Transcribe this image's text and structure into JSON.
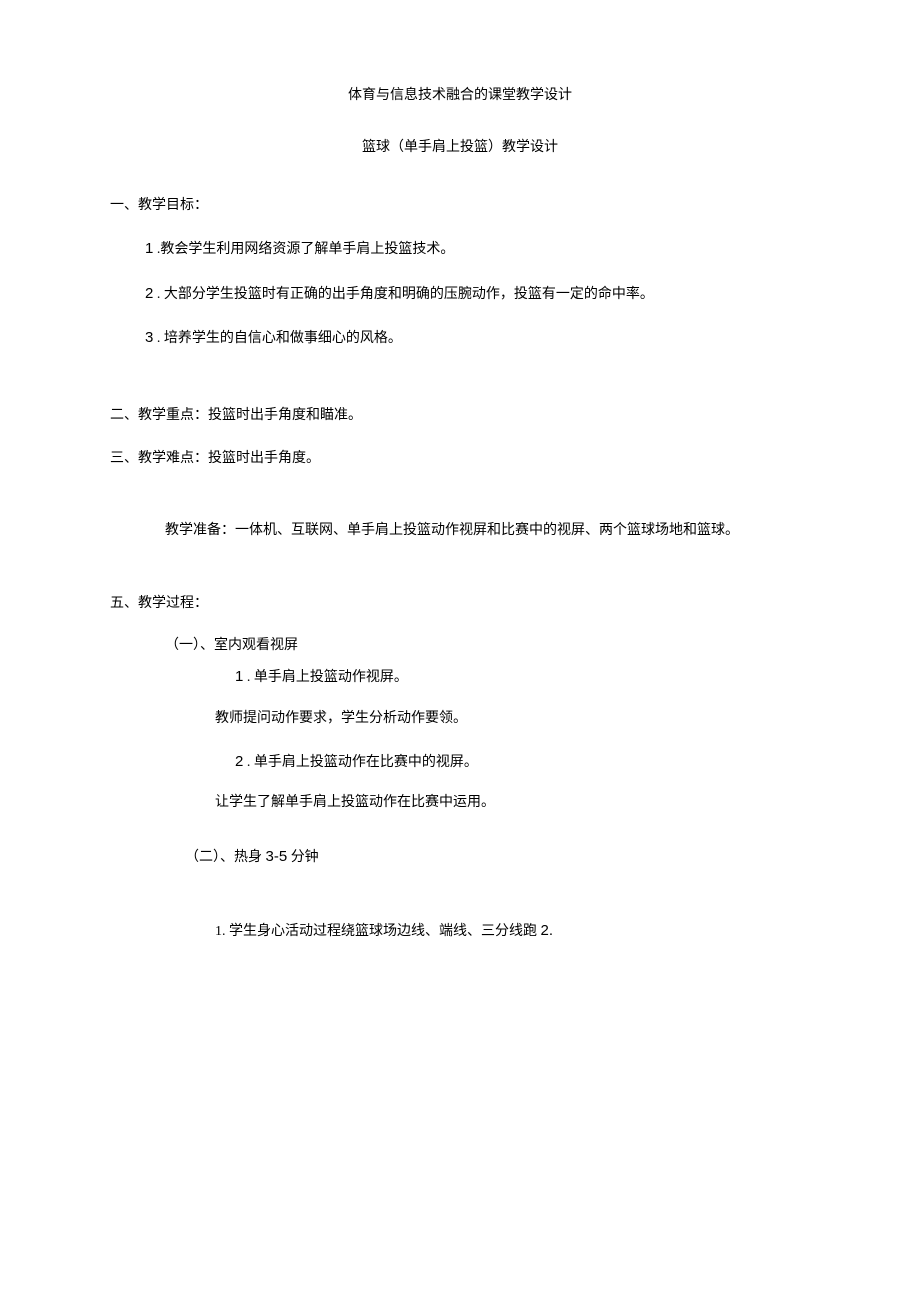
{
  "title": "体育与信息技术融合的课堂教学设计",
  "subtitle": "篮球（单手肩上投篮）教学设计",
  "section1": {
    "heading": "一、教学目标：",
    "item1_num": "1",
    "item1_text": " .教会学生利用网络资源了解单手肩上投篮技术。",
    "item2_num": "2",
    "item2_text": " . 大部分学生投篮时有正确的出手角度和明确的压腕动作，投篮有一定的命中率。",
    "item3_num": "3",
    "item3_text": " . 培养学生的自信心和做事细心的风格。"
  },
  "section2": "二、教学重点：投篮时出手角度和瞄准。",
  "section3": "三、教学难点：投篮时出手角度。",
  "section4": "教学准备：一体机、互联网、单手肩上投篮动作视屏和比赛中的视屏、两个篮球场地和篮球。",
  "section5": {
    "heading": "五、教学过程：",
    "sub1_heading": "（一）、室内观看视屏",
    "sub1_item1_num": "1",
    "sub1_item1_text": " . 单手肩上投篮动作视屏。",
    "sub1_item1_desc": "教师提问动作要求，学生分析动作要领。",
    "sub1_item2_num": "2",
    "sub1_item2_text": " . 单手肩上投篮动作在比赛中的视屏。",
    "sub1_item2_desc": "让学生了解单手肩上投篮动作在比赛中运用。",
    "sub2_heading_pre": "（二）、热身 ",
    "sub2_heading_num": "3-5",
    "sub2_heading_post": " 分钟",
    "sub2_item1_pre": "1. 学生身心活动过程绕篮球场边线、端线、三分线跑 ",
    "sub2_item1_num": "2.",
    "sub2_item1_post": ""
  }
}
